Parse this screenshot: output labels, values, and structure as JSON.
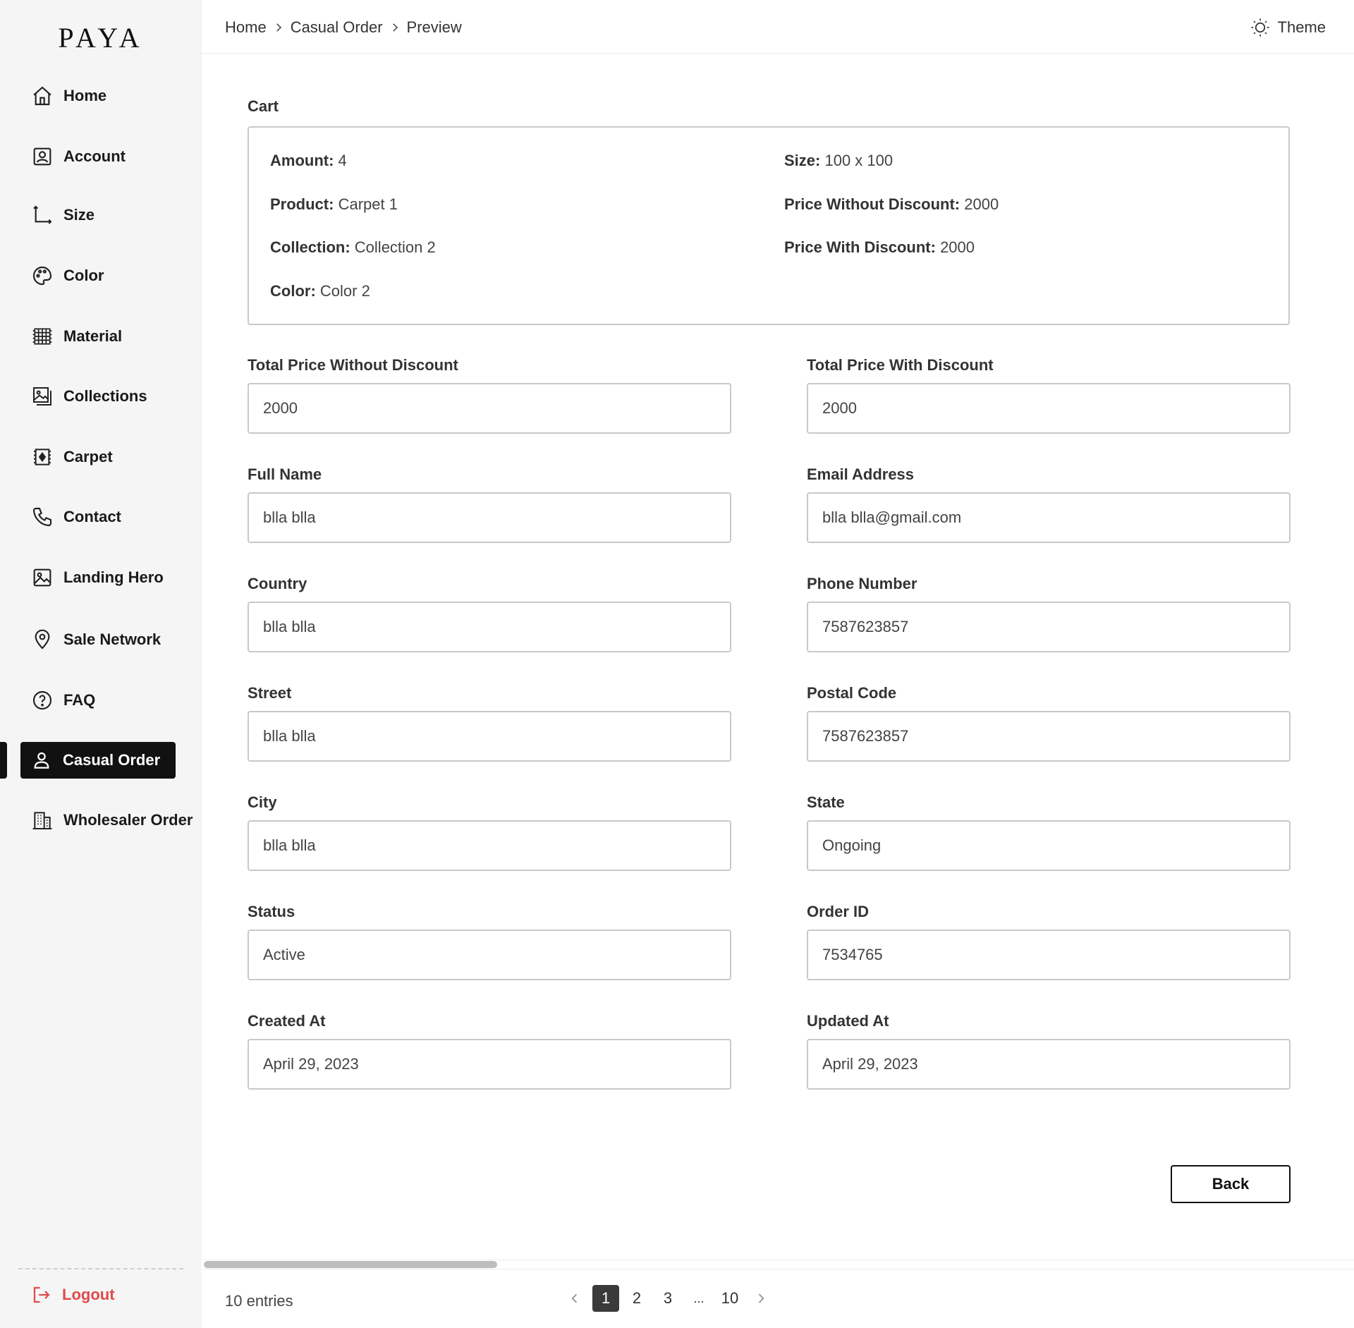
{
  "brand": {
    "logo": "PAYA"
  },
  "sidebar": {
    "items": [
      {
        "label": "Home",
        "icon": "home-icon"
      },
      {
        "label": "Account",
        "icon": "account-icon"
      },
      {
        "label": "Size",
        "icon": "size-icon"
      },
      {
        "label": "Color",
        "icon": "palette-icon"
      },
      {
        "label": "Material",
        "icon": "material-icon"
      },
      {
        "label": "Collections",
        "icon": "collections-icon"
      },
      {
        "label": "Carpet",
        "icon": "carpet-icon"
      },
      {
        "label": "Contact",
        "icon": "phone-icon"
      },
      {
        "label": "Landing Hero",
        "icon": "image-icon"
      },
      {
        "label": "Sale Network",
        "icon": "location-pin-icon"
      },
      {
        "label": "FAQ",
        "icon": "question-icon"
      },
      {
        "label": "Casual Order",
        "icon": "user-icon",
        "active": true
      },
      {
        "label": "Wholesaler Order",
        "icon": "building-icon"
      }
    ],
    "logout_label": "Logout"
  },
  "header": {
    "breadcrumb": [
      "Home",
      "Casual Order",
      "Preview"
    ],
    "theme_label": "Theme"
  },
  "cart": {
    "title": "Cart",
    "amount_label": "Amount:",
    "amount_value": "4",
    "product_label": "Product:",
    "product_value": "Carpet 1",
    "collection_label": "Collection:",
    "collection_value": "Collection 2",
    "color_label": "Color:",
    "color_value": "Color 2",
    "size_label": "Size:",
    "size_value": "100 x 100",
    "price_without_label": "Price Without Discount:",
    "price_without_value": "2000",
    "price_with_label": "Price With Discount:",
    "price_with_value": "2000"
  },
  "form": {
    "total_price_without_discount": {
      "label": "Total Price Without Discount",
      "value": "2000"
    },
    "total_price_with_discount": {
      "label": "Total Price With Discount",
      "value": "2000"
    },
    "full_name": {
      "label": "Full Name",
      "value": "blla blla"
    },
    "email_address": {
      "label": "Email Address",
      "value": "blla blla@gmail.com"
    },
    "country": {
      "label": "Country",
      "value": "blla blla"
    },
    "phone_number": {
      "label": "Phone Number",
      "value": "7587623857"
    },
    "street": {
      "label": "Street",
      "value": "blla blla"
    },
    "postal_code": {
      "label": "Postal Code",
      "value": "7587623857"
    },
    "city": {
      "label": "City",
      "value": "blla blla"
    },
    "state": {
      "label": "State",
      "value": "Ongoing"
    },
    "status": {
      "label": "Status",
      "value": "Active"
    },
    "order_id": {
      "label": "Order ID",
      "value": "7534765"
    },
    "created_at": {
      "label": "Created At",
      "value": "April 29, 2023"
    },
    "updated_at": {
      "label": "Updated At",
      "value": "April 29, 2023"
    }
  },
  "actions": {
    "back_label": "Back"
  },
  "footer": {
    "entries_text": "10 entries",
    "pages": [
      "1",
      "2",
      "3",
      "...",
      "10"
    ],
    "current_page": "1"
  }
}
